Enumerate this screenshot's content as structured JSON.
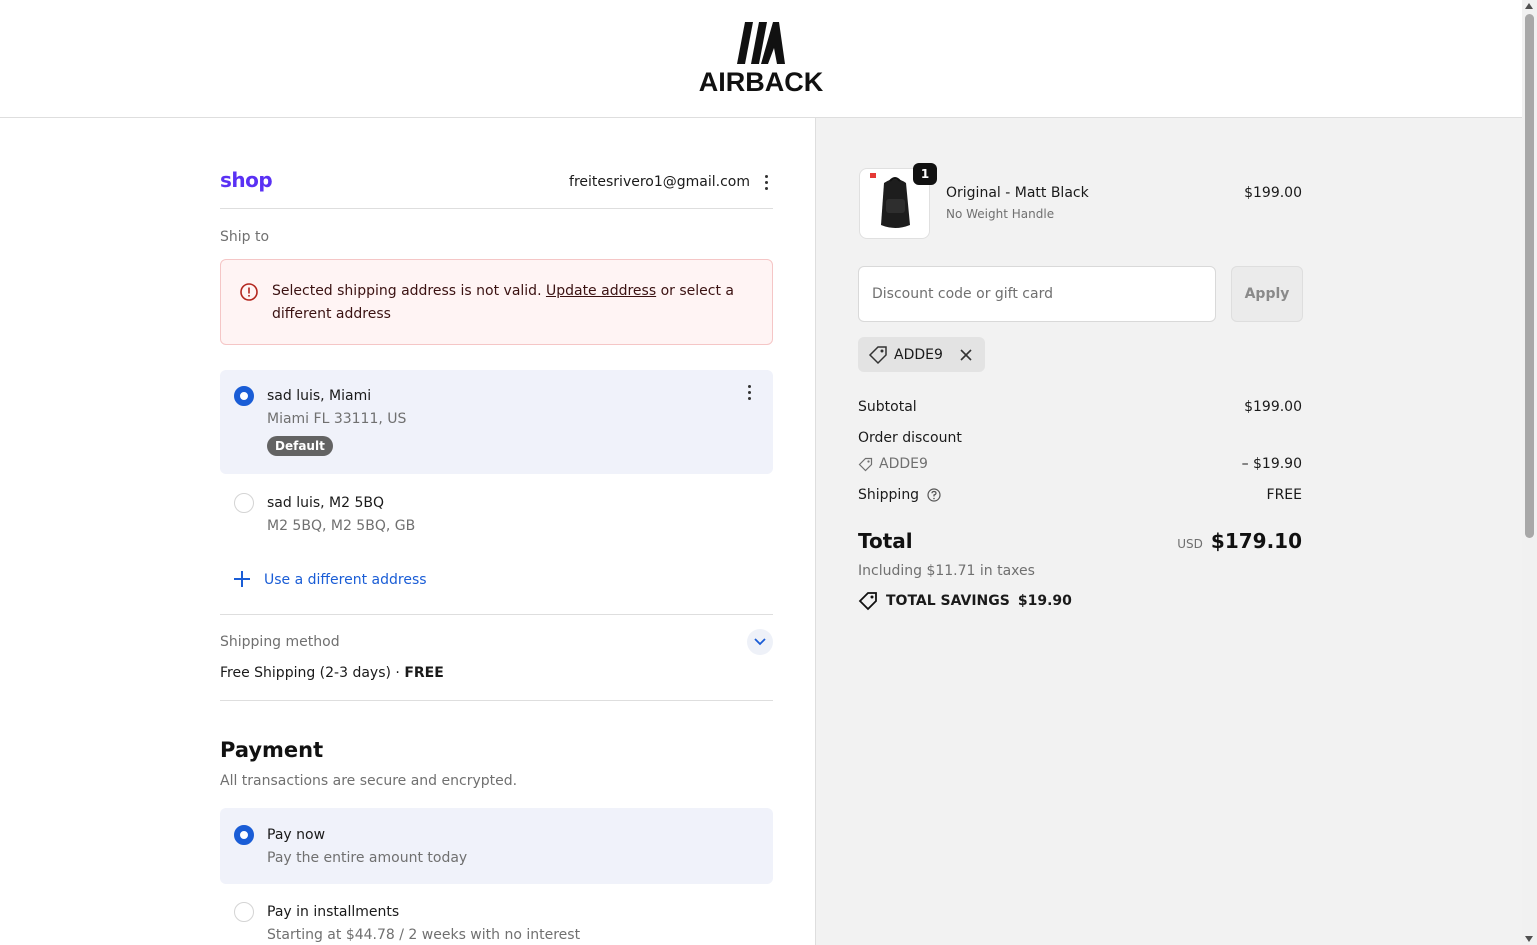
{
  "brand": {
    "name": "AIRBACK"
  },
  "account": {
    "shop_logo": "shop",
    "email": "freitesrivero1@gmail.com"
  },
  "ship_to": {
    "label": "Ship to",
    "alert": {
      "text_before": "Selected shipping address is not valid. ",
      "link": "Update address",
      "text_after": " or select a different address"
    },
    "addresses": [
      {
        "line1": "sad luis, Miami",
        "line2": "Miami FL 33111, US",
        "badge": "Default",
        "selected": true
      },
      {
        "line1": "sad luis, M2 5BQ",
        "line2": "M2 5BQ, M2 5BQ, GB",
        "selected": false
      }
    ],
    "use_different": "Use a different address"
  },
  "shipping_method": {
    "label": "Shipping method",
    "value": "Free Shipping (2-3 days) · ",
    "price": "FREE"
  },
  "payment": {
    "title": "Payment",
    "subtitle": "All transactions are secure and encrypted.",
    "options": [
      {
        "title": "Pay now",
        "desc": "Pay the entire amount today",
        "selected": true
      },
      {
        "title": "Pay in installments",
        "desc": "Starting at $44.78 / 2 weeks with no interest",
        "selected": false
      }
    ]
  },
  "summary": {
    "product": {
      "name": "Original - Matt Black",
      "variant": "No Weight Handle",
      "price": "$199.00",
      "quantity": "1"
    },
    "discount": {
      "placeholder": "Discount code or gift card",
      "apply": "Apply",
      "applied_code": "ADDE9"
    },
    "subtotal_label": "Subtotal",
    "subtotal": "$199.00",
    "order_discount_label": "Order discount",
    "order_discount_code": "ADDE9",
    "order_discount": "– $19.90",
    "shipping_label": "Shipping",
    "shipping": "FREE",
    "total_label": "Total",
    "currency": "USD",
    "total": "$179.10",
    "taxes": "Including $11.71 in taxes",
    "savings_label": "TOTAL SAVINGS",
    "savings": "$19.90"
  },
  "colors": {
    "accent": "#1a5dd6",
    "shop_purple": "#5a31f4",
    "summary_bg": "#f2f2f2",
    "alert_bg": "#fff4f4"
  }
}
